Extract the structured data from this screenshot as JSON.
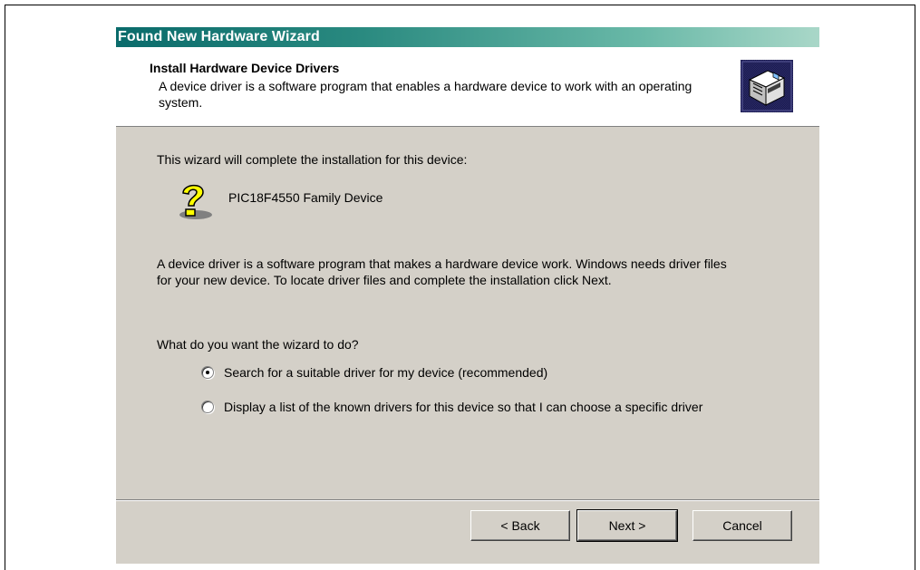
{
  "window": {
    "title": "Found New Hardware Wizard"
  },
  "header": {
    "title": "Install Hardware Device Drivers",
    "subtitle": "A device driver is a software program that enables a hardware device to work with an operating system.",
    "icon": "hardware-device-icon"
  },
  "main": {
    "intro": "This wizard will complete the installation for this device:",
    "device_icon": "question-mark-icon",
    "device_name": "PIC18F4550 Family Device",
    "description": "A device driver is a software program that makes a hardware device work. Windows needs driver files for your new device. To locate driver files and complete the installation click Next.",
    "question": "What do you want the wizard to do?",
    "options": [
      {
        "label": "Search for a suitable driver for my device (recommended)",
        "selected": true
      },
      {
        "label": "Display a list of the known drivers for this device so that I can choose a specific driver",
        "selected": false
      }
    ]
  },
  "buttons": {
    "back": "< Back",
    "next": "Next >",
    "cancel": "Cancel"
  },
  "colors": {
    "dialog_bg": "#d4d0c8",
    "title_start": "#0a6b6b",
    "title_end": "#a9d7c8"
  }
}
